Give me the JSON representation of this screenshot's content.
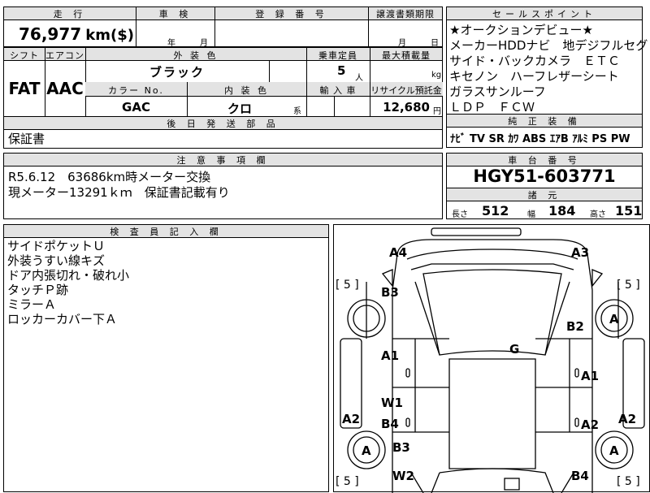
{
  "top": {
    "mileage_label": "走 行",
    "mileage_value": "76,977",
    "mileage_unit": "km($)",
    "shaken_label": "車 検",
    "shaken_year_unit": "年",
    "shaken_month_unit": "月",
    "reg_label": "登 録 番 号",
    "transfer_label": "譲渡書類期限",
    "transfer_month_unit": "月",
    "transfer_day_unit": "日"
  },
  "spec": {
    "shift_label": "シフト",
    "ac_label": "エアコン",
    "shift_value": "FAT",
    "ac_value": "AAC",
    "ext_color_label": "外 装 色",
    "ext_color_value": "ブラック",
    "capacity_label": "乗車定員",
    "capacity_value": "5",
    "capacity_unit": "人",
    "maxload_label": "最大積載量",
    "maxload_unit": "kg",
    "colorno_label": "カラー No.",
    "colorno_value": "GAC",
    "interior_label": "内 装 色",
    "interior_value": "クロ",
    "interior_suffix": "系",
    "import_label": "輸 入 車",
    "recycle_label": "リサイクル預託金",
    "recycle_value": "12,680",
    "recycle_unit": "円"
  },
  "delivery": {
    "label": "後 日 発 送 部 品",
    "value": "保証書"
  },
  "notes": {
    "label": "注 意 事 項 欄",
    "line1": "R5.6.12　63686km時メーター交換",
    "line2": "現メーター13291ｋｍ　保証書記載有り"
  },
  "sales": {
    "label": "セールスポイント",
    "lines": [
      "★オークションデビュー★",
      "メーカーHDDナビ　地デジフルセグ",
      "サイド・バックカメラ　ＥＴＣ",
      "キセノン　ハーフレザーシート",
      "ガラスサンルーフ",
      "ＬＤＰ　ＦＣＷ"
    ]
  },
  "equipment": {
    "label": "純 正 装 備",
    "items": [
      "ﾅﾋﾞ",
      "TV",
      "SR",
      "ｶﾜ",
      "ABS",
      "ｴｱB",
      "ｱﾙﾐ",
      "PS",
      "PW"
    ]
  },
  "chassis": {
    "label": "車 台 番 号",
    "value": "HGY51-603771"
  },
  "dims": {
    "label": "諸 元",
    "length_label": "長さ",
    "length_value": "512",
    "width_label": "幅",
    "width_value": "184",
    "height_label": "高さ",
    "height_value": "151"
  },
  "inspector": {
    "label": "検 査 員 記 入 欄",
    "lines": [
      "サイドポケットＵ",
      "外装うすい線キズ",
      "ドア内張切れ・破れ小",
      "タッチＰ跡",
      "ミラーＡ",
      "ロッカーカバー下Ａ"
    ]
  },
  "diagram": {
    "tread_labels": [
      "[ 5 ]",
      "[ 5 ]",
      "[ 5 ]",
      "[ 5 ]"
    ],
    "codes": {
      "a4": "A4",
      "a3": "A3",
      "b3_front": "B3",
      "b2": "B2",
      "a1_left": "A1",
      "g": "G",
      "a1_right": "A1",
      "w1": "W1",
      "a2_left": "A2",
      "b4_left": "B4",
      "a2_mid": "A2",
      "a2_right": "A2",
      "b3_rear": "B3",
      "w2": "W2",
      "b4_rear": "B4"
    },
    "wheels": [
      "A",
      "A",
      "A"
    ]
  }
}
